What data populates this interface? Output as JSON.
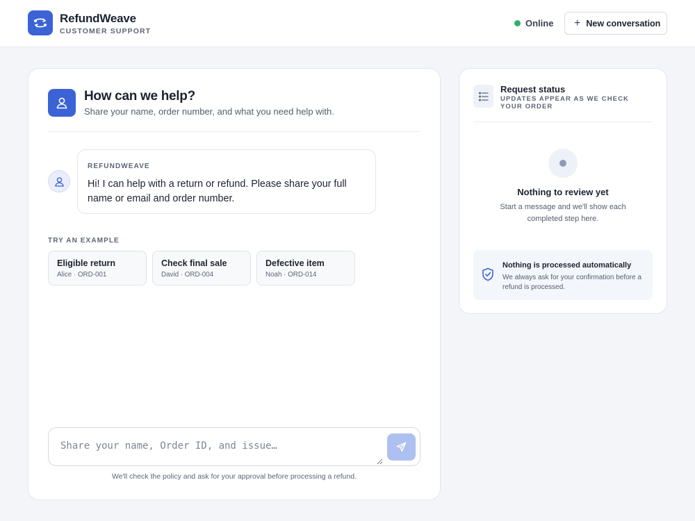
{
  "header": {
    "brand_name": "RefundWeave",
    "brand_sub": "CUSTOMER SUPPORT",
    "status": "Online",
    "new_conversation": "New conversation"
  },
  "chat": {
    "title": "How can we help?",
    "subtitle": "Share your name, order number, and what you need help with.",
    "message": {
      "sender": "REFUNDWEAVE",
      "text": "Hi! I can help with a return or refund. Please share your full name or email and order number."
    },
    "examples_heading": "TRY AN EXAMPLE",
    "examples": [
      {
        "title": "Eligible return",
        "meta": "Alice · ORD-001"
      },
      {
        "title": "Check final sale",
        "meta": "David · ORD-004"
      },
      {
        "title": "Defective item",
        "meta": "Noah · ORD-014"
      }
    ],
    "input_placeholder": "Share your name, Order ID, and issue…",
    "input_value": "",
    "footnote": "We'll check the policy and ask for your approval before processing a refund."
  },
  "status_panel": {
    "title": "Request status",
    "subtitle": "UPDATES APPEAR AS WE CHECK YOUR ORDER",
    "empty_title": "Nothing to review yet",
    "empty_text": "Start a message and we'll show each completed step here.",
    "notice_title": "Nothing is processed automatically",
    "notice_text": "We always ask for your confirmation before a refund is processed."
  },
  "colors": {
    "accent": "#3b63d6",
    "online": "#2fb06b",
    "send_disabled": "#aec0ef"
  },
  "icons": {
    "brand": "refund-cycle-icon",
    "help": "user-icon",
    "bot": "user-icon",
    "send": "send-icon",
    "status": "checklist-icon",
    "notice": "shield-check-icon"
  }
}
